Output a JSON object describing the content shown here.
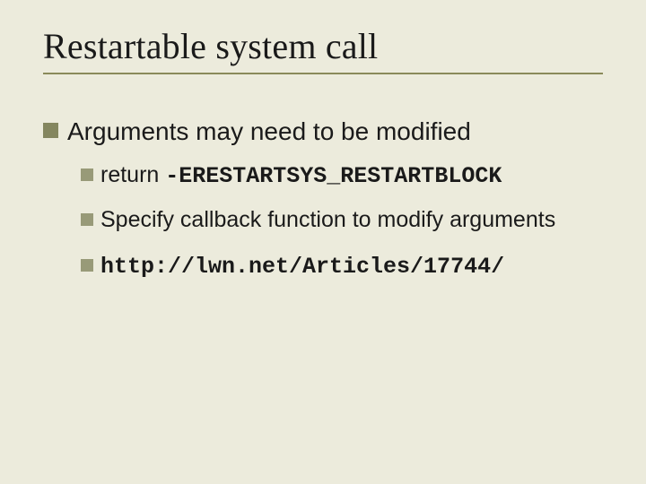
{
  "title": "Restartable system call",
  "lvl1": {
    "text": "Arguments may need to be modified"
  },
  "items": [
    {
      "pre": "return ",
      "code": "-ERESTARTSYS_RESTARTBLOCK"
    },
    {
      "pre": "Specify callback function to modify arguments",
      "code": ""
    },
    {
      "pre": "",
      "code": "http://lwn.net/Articles/17744/"
    }
  ]
}
